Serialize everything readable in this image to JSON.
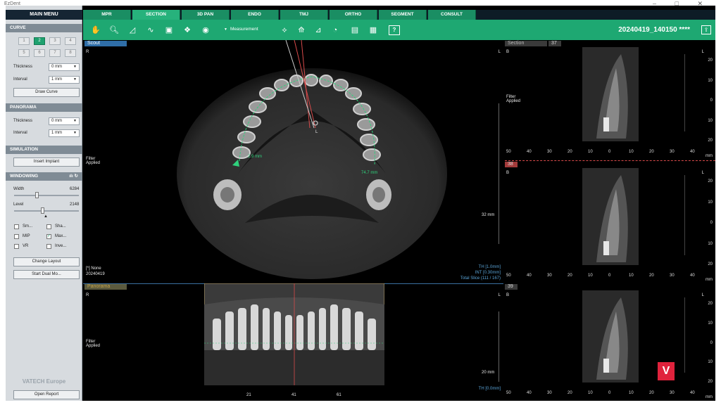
{
  "window": {
    "title": "EzDent",
    "controls": "– □ ✕"
  },
  "left_panel": {
    "main_menu": "MAIN MENU",
    "curve": {
      "header": "CURVE",
      "buttons": [
        "1",
        "2",
        "3",
        "4",
        "5",
        "6",
        "7",
        "8"
      ],
      "active_button": "2",
      "thickness_label": "Thickness",
      "thickness_value": "0 mm",
      "interval_label": "Interval",
      "interval_value": "1 mm",
      "draw_curve": "Draw Curve"
    },
    "panorama": {
      "header": "PANORAMA",
      "thickness_label": "Thickness",
      "thickness_value": "0 mm",
      "interval_label": "Interval",
      "interval_value": "1 mm"
    },
    "simulation": {
      "header": "SIMULATION",
      "insert_implant": "Insert Implant"
    },
    "windowing": {
      "header": "WINDOWING",
      "width_label": "Width",
      "width_value": "6284",
      "level_label": "Level",
      "level_value": "2148",
      "checkboxes": [
        {
          "label": "Sm...",
          "checked": false
        },
        {
          "label": "Sha...",
          "checked": false
        },
        {
          "label": "MIP",
          "checked": false
        },
        {
          "label": "Max...",
          "checked": true
        },
        {
          "label": "VR",
          "checked": false
        },
        {
          "label": "Inve...",
          "checked": false
        }
      ]
    },
    "change_layout": "Change Layout",
    "start_dual": "Start Dual Mo...",
    "brand": "VATECH Europe",
    "open_report": "Open Report"
  },
  "tabs": [
    "MPR",
    "SECTION",
    "3D PAN",
    "ENDO",
    "TMJ",
    "ORTHO",
    "SEGMENT",
    "CONSULT"
  ],
  "active_tab": "SECTION",
  "toolbar": {
    "measurement_label": "Measurement",
    "patient_id": "20240419_140150 ****",
    "help": "?"
  },
  "scout": {
    "header": "Scout",
    "orient_left": "R",
    "orient_right": "L",
    "filter": "Filter\nApplied",
    "bottom_left_1": "[*] None",
    "bottom_left_2": "20240419",
    "bottom_right_1": "TH [1.0mm]",
    "bottom_right_2": "INT [0.30mm]",
    "bottom_right_3": "Total Slice (111 / 167)",
    "scale_label": "32 mm",
    "measure_1": "2.9 mm",
    "measure_2": "74.7 mm",
    "mark_l": "L"
  },
  "panorama_view": {
    "header": "Panorama",
    "orient_left": "R",
    "orient_right": "L",
    "filter": "Filter\nApplied",
    "scale_label": "20 mm",
    "th": "TH [0.0mm]",
    "x_ticks": [
      "21",
      "41",
      "61"
    ]
  },
  "sections": [
    {
      "header": "Section",
      "number": "37",
      "orient_b": "B",
      "orient_l": "L",
      "filter": "Filter\nApplied",
      "y_ticks": [
        "20",
        "10",
        "0",
        "10",
        "20"
      ],
      "x_ticks": [
        "50",
        "40",
        "30",
        "20",
        "10",
        "0",
        "10",
        "20",
        "30",
        "40"
      ],
      "unit": "mm"
    },
    {
      "header": "",
      "number": "38",
      "orient_b": "B",
      "orient_l": "L",
      "filter": "",
      "y_ticks": [
        "20",
        "10",
        "0",
        "10",
        "20"
      ],
      "x_ticks": [
        "50",
        "40",
        "30",
        "20",
        "10",
        "0",
        "10",
        "20",
        "30",
        "40"
      ],
      "unit": "mm"
    },
    {
      "header": "",
      "number": "39",
      "orient_b": "B",
      "orient_l": "L",
      "filter": "",
      "y_ticks": [
        "20",
        "10",
        "0",
        "10",
        "20"
      ],
      "x_ticks": [
        "50",
        "40",
        "30",
        "20",
        "10",
        "0",
        "10",
        "20",
        "30",
        "40"
      ],
      "unit": "mm"
    }
  ],
  "logo_letter": "V"
}
